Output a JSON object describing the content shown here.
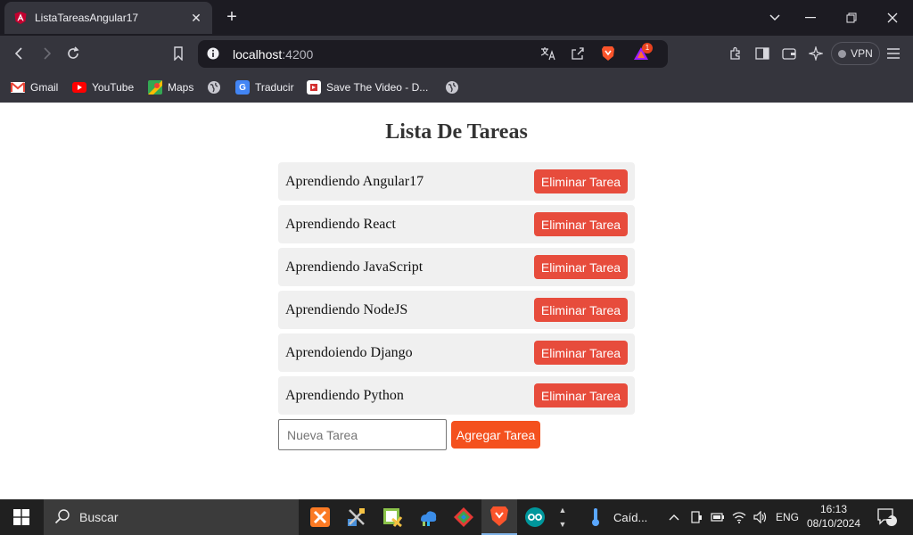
{
  "browser": {
    "tab_title": "ListaTareasAngular17",
    "url_host": "localhost",
    "url_port": ":4200",
    "notification_count": "1",
    "vpn_label": "VPN"
  },
  "bookmarks": [
    {
      "label": "Gmail"
    },
    {
      "label": "YouTube"
    },
    {
      "label": "Maps"
    },
    {
      "label": "Traducir"
    },
    {
      "label": "Save The Video - D..."
    }
  ],
  "page": {
    "title": "Lista De Tareas",
    "tasks": [
      {
        "text": "Aprendiendo Angular17",
        "button": "Eliminar Tarea"
      },
      {
        "text": "Aprendiendo React",
        "button": "Eliminar Tarea"
      },
      {
        "text": "Aprendiendo JavaScript",
        "button": "Eliminar Tarea"
      },
      {
        "text": "Aprendiendo NodeJS",
        "button": "Eliminar Tarea"
      },
      {
        "text": "Aprendoiendo Django",
        "button": "Eliminar Tarea"
      },
      {
        "text": "Aprendiendo Python",
        "button": "Eliminar Tarea"
      }
    ],
    "new_task_placeholder": "Nueva Tarea",
    "add_button": "Agregar Tarea"
  },
  "taskbar": {
    "search_label": "Buscar",
    "weather_label": "Caíd...",
    "language": "ENG",
    "time": "16:13",
    "date": "08/10/2024",
    "notifications": "2"
  },
  "colors": {
    "delete_button": "#e74c3c",
    "add_button": "#f4511e",
    "task_bg": "#f0f0f0"
  }
}
